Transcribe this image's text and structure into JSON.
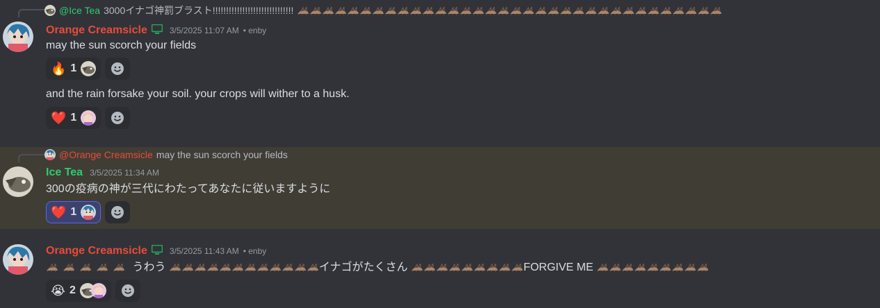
{
  "messages": [
    {
      "reply": {
        "author": "@Ice Tea",
        "text": "3000イナゴ神罰ブラスト!!!!!!!!!!!!!!!!!!!!!!!!!!!!!!"
      },
      "author": "Orange Creamsicle",
      "timestamp": "3/5/2025 11:07 AM",
      "tag": "• enby",
      "lines": [
        {
          "text": "may the sun scorch your fields",
          "reactions": [
            {
              "emoji": "🔥",
              "count": "1"
            }
          ]
        },
        {
          "text": "and the rain forsake your soil. your crops will wither to a husk.",
          "reactions": [
            {
              "emoji": "❤️",
              "count": "1"
            }
          ]
        }
      ]
    },
    {
      "reply": {
        "author": "@Orange Creamsicle",
        "text": "may the sun scorch your fields"
      },
      "author": "Ice Tea",
      "timestamp": "3/5/2025 11:34 AM",
      "lines": [
        {
          "text": "300の疫病の神が三代にわたってあなたに従いますように",
          "reactions": [
            {
              "emoji": "❤️",
              "count": "1"
            }
          ]
        }
      ]
    },
    {
      "author": "Orange Creamsicle",
      "timestamp": "3/5/2025 11:43 AM",
      "tag": "• enby",
      "segments": [
        "うわう",
        "イナゴがたくさん",
        "FORGIVE ME"
      ],
      "reactions": [
        {
          "emoji": "😭",
          "count": "2"
        }
      ]
    }
  ],
  "colors": {
    "background": "#313338",
    "highlight": "#403d35",
    "orange_name": "#e74c3c",
    "green_name": "#2ecc71"
  },
  "icons": [
    "desktop-icon",
    "add-reaction-icon",
    "cricket-emoji"
  ]
}
